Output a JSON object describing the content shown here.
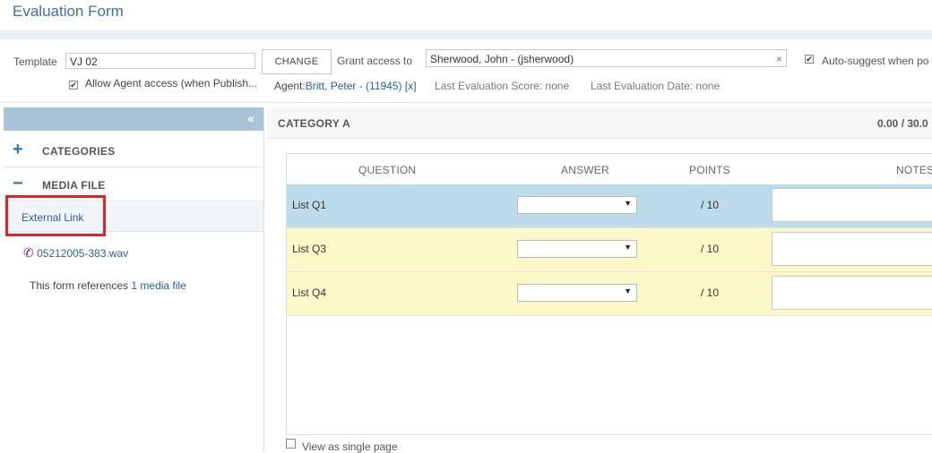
{
  "window": {
    "title": "Evaluation Form"
  },
  "form": {
    "template_label": "Template",
    "template_value": "VJ 02",
    "change_button": "CHANGE",
    "grant_access_label": "Grant access to",
    "grant_access_value": "Sherwood, John - (jsherwood)",
    "clear_icon": "×",
    "auto_suggest_label": "Auto-suggest when po",
    "auto_suggest_checked": true,
    "allow_agent_label": "Allow Agent access (when Publish...",
    "allow_agent_checked": true,
    "agent_prefix": "Agent:",
    "agent_name": "Britt, Peter - (11945)",
    "agent_remove": "[x]",
    "last_score_label": "Last Evaluation Score:",
    "last_score_value": "none",
    "last_date_label": "Last Evaluation Date:",
    "last_date_value": "none"
  },
  "left_panel": {
    "collapse_icon": "«",
    "categories": {
      "icon": "+",
      "label": "CATEGORIES"
    },
    "media_file": {
      "icon": "−",
      "label": "MEDIA FILE"
    },
    "external_link": "External Link",
    "file": {
      "icon": "phone-icon",
      "name": "05212005-383.wav"
    },
    "references_text": "This form references",
    "references_link": "1 media file"
  },
  "category": {
    "name": "CATEGORY A",
    "score": "0.00 / 30.0",
    "columns": [
      "QUESTION",
      "ANSWER",
      "POINTS",
      "NOTES"
    ],
    "rows": [
      {
        "question": "List Q1",
        "points": "/ 10"
      },
      {
        "question": "List Q3",
        "points": "/ 10"
      },
      {
        "question": "List Q4",
        "points": "/ 10"
      }
    ],
    "view_single_page": "View as single page"
  },
  "colors": {
    "title": "#3a6fa8",
    "accent_blue": "#2a78b8",
    "selected_row": "#bcdcec",
    "highlight_row": "#fcf8c8",
    "annotation_red": "#e0212b"
  }
}
